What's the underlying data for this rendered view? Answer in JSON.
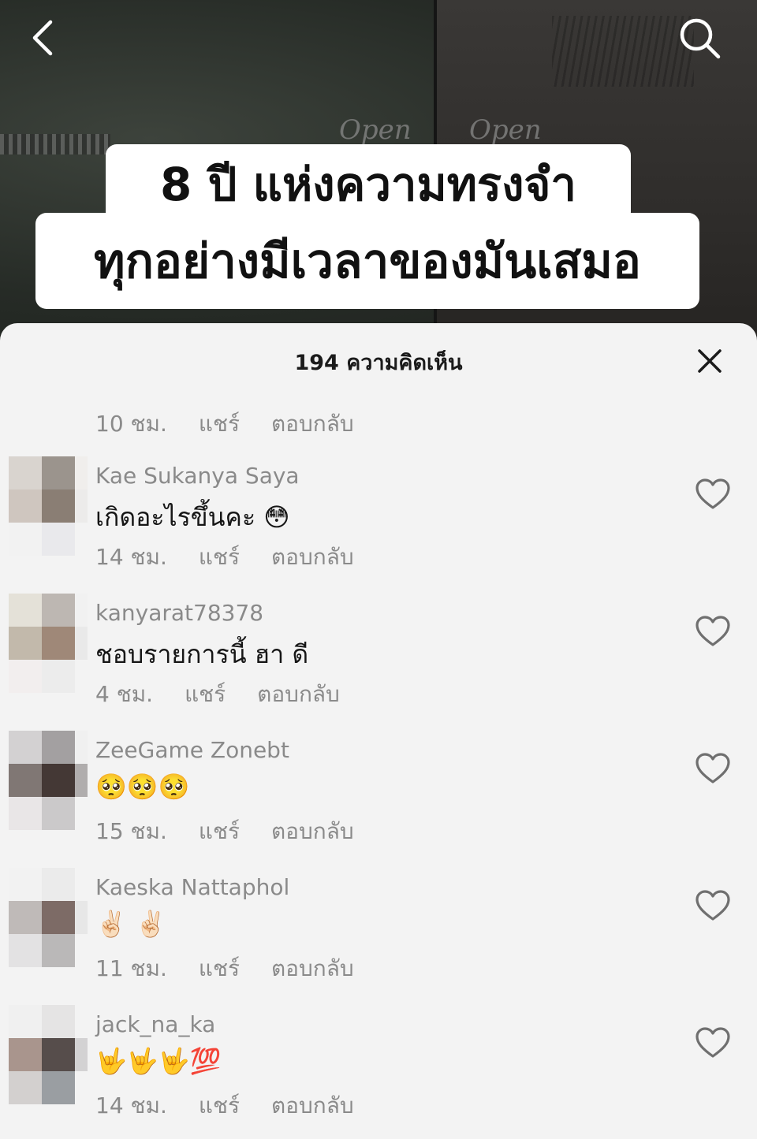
{
  "video": {
    "caption_line1": "8 ปี แห่งความทรงจำ",
    "caption_line2": "ทุกอย่างมีเวลาของมันเสมอ",
    "cursive_left": "Open",
    "cursive_right": "Open",
    "back_icon": "chevron-left-icon",
    "search_icon": "search-icon"
  },
  "comments_panel": {
    "title": "194 ความคิดเห็น",
    "close_icon": "close-icon",
    "share_label": "แชร์",
    "reply_label": "ตอบกลับ",
    "partial_top": {
      "time": "10 ชม."
    },
    "comments": [
      {
        "username": "Kae Sukanya Saya",
        "text": "เกิดอะไรขึ้นคะ 😳",
        "time": "14 ชม.",
        "avatar_colors": [
          "#d9d4cf",
          "#9b948d",
          "#f0eeec",
          "#cfc6bf",
          "#8a7e74",
          "#ecebea",
          "#f2f2f2",
          "#e9e9ec",
          "#f3f3f3"
        ]
      },
      {
        "username": "kanyarat78378",
        "text": "ชอบรายการนี้ ฮา ดี",
        "time": "4 ชม.",
        "avatar_colors": [
          "#e4e1d8",
          "#bdb7b2",
          "#f1f1f1",
          "#c2b9ab",
          "#9f8878",
          "#e9e9e9",
          "#f2eeee",
          "#ececec",
          "#f3f3f3"
        ]
      },
      {
        "username": "ZeeGame Zonebt",
        "text": "🥺🥺🥺",
        "time": "15 ชม.",
        "avatar_colors": [
          "#d3d1d2",
          "#a3a0a1",
          "#f0f0f0",
          "#807774",
          "#443835",
          "#b0adad",
          "#e9e6e7",
          "#cbc9ca",
          "#f3f3f3"
        ]
      },
      {
        "username": "Kaeska Nattaphol",
        "text": "✌🏻 ✌🏻",
        "time": "11 ชม.",
        "avatar_colors": [
          "#f2f2f2",
          "#ebebeb",
          "#f3f3f3",
          "#bfbab8",
          "#7d6b66",
          "#e7e7e7",
          "#e3e2e3",
          "#bab8b8",
          "#f3f3f3"
        ]
      },
      {
        "username": "jack_na_ka",
        "text": "🤟🤟🤟💯",
        "time": "14 ชม.",
        "avatar_colors": [
          "#f0f0f0",
          "#e5e4e4",
          "#f3f3f3",
          "#a9958d",
          "#564d4b",
          "#d3d2d3",
          "#d3d0cf",
          "#9a9ea2",
          "#f3f3f3"
        ]
      }
    ],
    "like_icon": "heart-outline-icon"
  }
}
